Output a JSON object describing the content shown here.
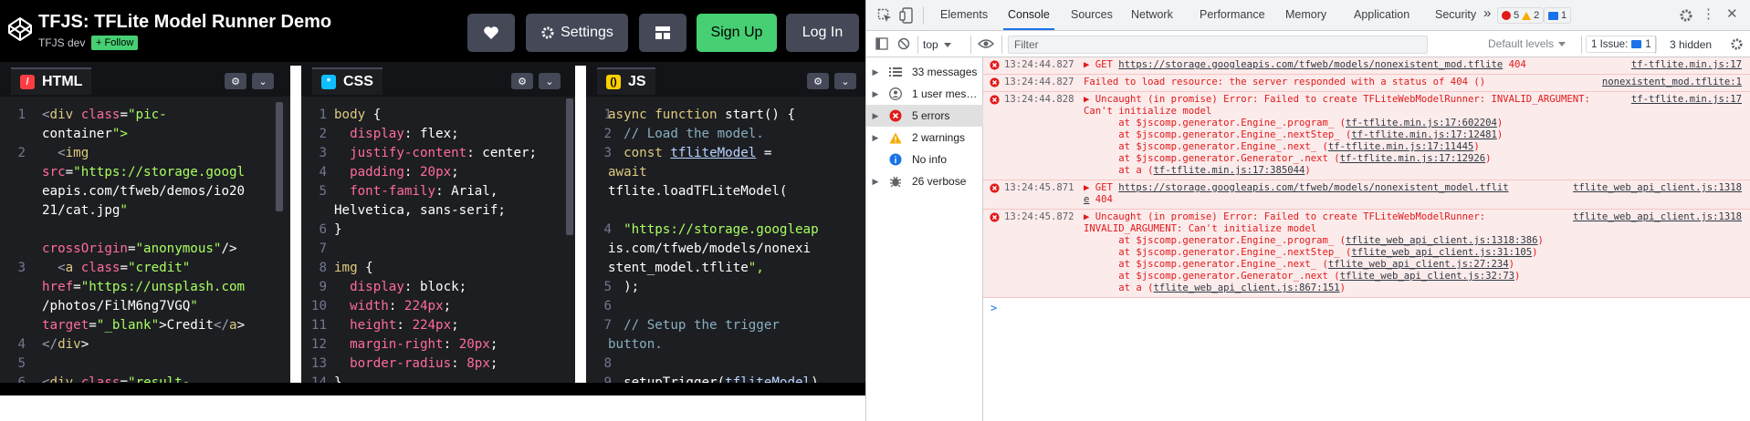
{
  "codepen": {
    "title": "TFJS: TFLite Model Runner Demo",
    "author": "TFJS dev",
    "follow_label": "Follow",
    "buttons": {
      "settings": "Settings",
      "signup": "Sign Up",
      "login": "Log In"
    },
    "panels": [
      {
        "name": "HTML",
        "badge": "/",
        "badge_color": "#ff3c41"
      },
      {
        "name": "CSS",
        "badge": "*",
        "badge_color": "#0ebeff"
      },
      {
        "name": "JS",
        "badge": "()",
        "badge_color": "#fcd000"
      }
    ],
    "html_code": [
      "<div class=\"pic-",
      "container\">",
      "  <img",
      "src=\"https://storage.googl",
      "eapis.com/tfweb/demos/io20",
      "21/cat.jpg\"",
      "",
      "crossOrigin=\"anonymous\"/>",
      "  <a class=\"credit\"",
      "href=\"https://unsplash.com",
      "/photos/FilM6ng7VGQ\"",
      "target=\"_blank\">Credit</a>",
      "</div>",
      "",
      "<div class=\"result-"
    ],
    "html_lines": [
      "1",
      "",
      "2",
      "",
      "",
      "",
      "",
      "",
      "3",
      "",
      "",
      "",
      "4",
      "5",
      "6"
    ],
    "css_code": [
      "body {",
      "  display: flex;",
      "  justify-content: center;",
      "  padding: 20px;",
      "  font-family: Arial,",
      "Helvetica, sans-serif;",
      "}",
      "",
      "img {",
      "  display: block;",
      "  width: 224px;",
      "  height: 224px;",
      "  margin-right: 20px;",
      "  border-radius: 8px;",
      "}"
    ],
    "css_lines": [
      "1",
      "2",
      "3",
      "4",
      "5",
      "",
      "6",
      "7",
      "8",
      "9",
      "10",
      "11",
      "12",
      "13",
      "14"
    ],
    "js_code": [
      "async function start() {",
      "  // Load the model.",
      "  const tfliteModel =",
      "await",
      "tflite.loadTFLiteModel(",
      "",
      "  \"https://storage.googleap",
      "is.com/tfweb/models/nonexi",
      "stent_model.tflite\",",
      "  );",
      "",
      "  // Setup the trigger",
      "button.",
      "",
      "  setupTrigger(tfliteModel)"
    ],
    "js_lines": [
      "1",
      "2",
      "3",
      "",
      "",
      "",
      "4",
      "",
      "",
      "5",
      "6",
      "7",
      "",
      "8",
      "9"
    ]
  },
  "devtools": {
    "tabs": [
      "Elements",
      "Console",
      "Sources",
      "Network",
      "Performance",
      "Memory",
      "Application",
      "Security"
    ],
    "more_tabs": "»",
    "error_count": "5",
    "warning_count": "2",
    "info_count": "1",
    "context": "top",
    "filter_placeholder": "Filter",
    "levels": "Default levels",
    "issues": "1 Issue:",
    "issues_count": "1",
    "hidden": "3 hidden",
    "sidebar": [
      {
        "label": "33 messages",
        "icon": "list-icon"
      },
      {
        "label": "1 user mes…",
        "icon": "user-icon"
      },
      {
        "label": "5 errors",
        "icon": "error-icon"
      },
      {
        "label": "2 warnings",
        "icon": "warning-icon"
      },
      {
        "label": "No info",
        "icon": "info-icon"
      },
      {
        "label": "26 verbose",
        "icon": "bug-icon"
      }
    ],
    "messages": [
      {
        "time": "13:24:44.827",
        "lines": [
          [
            "▶ GET ",
            [
              "https://storage.googleapis.com/tfweb/models/nonexistent_mod.tflite"
            ],
            " 404"
          ]
        ],
        "source": "tf-tflite.min.js:17"
      },
      {
        "time": "13:24:44.827",
        "lines": [
          [
            "Failed to load resource: the server responded with a status of 404 ()"
          ]
        ],
        "source": "nonexistent_mod.tflite:1"
      },
      {
        "time": "13:24:44.828",
        "lines": [
          [
            "▶ Uncaught (in promise) Error: Failed to create TFLiteWebModelRunner: INVALID_ARGUMENT:"
          ],
          [
            "Can't initialize model"
          ],
          [
            "      at $jscomp.generator.Engine_.program_ (",
            [
              "tf-tflite.min.js:17:602204"
            ],
            ")"
          ],
          [
            "      at $jscomp.generator.Engine_.nextStep_ (",
            [
              "tf-tflite.min.js:17:12481"
            ],
            ")"
          ],
          [
            "      at $jscomp.generator.Engine_.next_ (",
            [
              "tf-tflite.min.js:17:11445"
            ],
            ")"
          ],
          [
            "      at $jscomp.generator.Generator_.next (",
            [
              "tf-tflite.min.js:17:12926"
            ],
            ")"
          ],
          [
            "      at a (",
            [
              "tf-tflite.min.js:17:385044"
            ],
            ")"
          ]
        ],
        "source": "tf-tflite.min.js:17"
      },
      {
        "time": "13:24:45.871",
        "lines": [
          [
            "▶ GET ",
            [
              "https://storage.googleapis.com/tfweb/models/nonexistent_model.tflit"
            ]
          ],
          [
            [
              "e"
            ],
            " 404"
          ]
        ],
        "source": "tflite_web_api_client.js:1318"
      },
      {
        "time": "13:24:45.872",
        "lines": [
          [
            "▶ Uncaught (in promise) Error: Failed to create TFLiteWebModelRunner:"
          ],
          [
            "INVALID_ARGUMENT: Can't initialize model"
          ],
          [
            "      at $jscomp.generator.Engine_.program_ (",
            [
              "tflite_web_api_client.js:1318:386"
            ],
            ")"
          ],
          [
            "      at $jscomp.generator.Engine_.nextStep_ (",
            [
              "tflite_web_api_client.js:31:105"
            ],
            ")"
          ],
          [
            "      at $jscomp.generator.Engine_.next_ (",
            [
              "tflite_web_api_client.js:27:234"
            ],
            ")"
          ],
          [
            "      at $jscomp.generator.Generator_.next (",
            [
              "tflite_web_api_client.js:32:73"
            ],
            ")"
          ],
          [
            "      at a (",
            [
              "tflite_web_api_client.js:867:151"
            ],
            ")"
          ]
        ],
        "source": "tflite_web_api_client.js:1318"
      }
    ],
    "prompt": ">"
  },
  "colors": {
    "codepen_green": "#47cf73",
    "error_red": "#e11a1a",
    "devtools_accent": "#1a73e8"
  }
}
